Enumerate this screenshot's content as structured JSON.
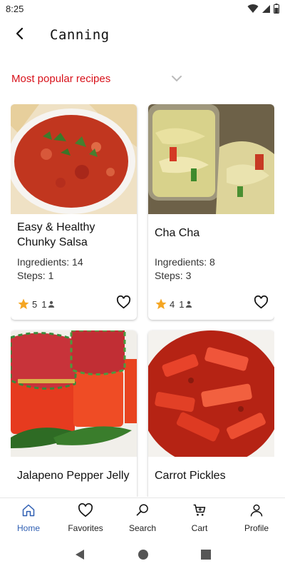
{
  "status_bar": {
    "time": "8:25",
    "icons": [
      "wifi-icon",
      "signal-icon",
      "battery-icon"
    ]
  },
  "app_bar": {
    "title": "Canning",
    "back_icon": "back-arrow-icon"
  },
  "sort": {
    "selected": "Most popular recipes",
    "icon": "chevron-down-icon"
  },
  "colors": {
    "accent": "#d8121b",
    "active_nav": "#2f5fb3",
    "star": "#f5a623"
  },
  "recipes": [
    {
      "title": "Easy & Healthy Chunky Salsa",
      "ingredients": "Ingredients: 14",
      "steps": "Steps: 1",
      "rating": "5",
      "reviews": "1",
      "image": "salsa bowl"
    },
    {
      "title": "Cha Cha",
      "ingredients": "Ingredients: 8",
      "steps": "Steps: 3",
      "rating": "4",
      "reviews": "1",
      "image": "cabbage relish jar"
    },
    {
      "title": "Jalapeno Pepper Jelly",
      "image": "pepper jelly jars"
    },
    {
      "title": "Carrot Pickles",
      "image": "carrot pickles bowl"
    }
  ],
  "nav": [
    {
      "label": "Home",
      "icon": "home-icon",
      "active": true
    },
    {
      "label": "Favorites",
      "icon": "heart-icon"
    },
    {
      "label": "Search",
      "icon": "search-icon"
    },
    {
      "label": "Cart",
      "icon": "cart-icon"
    },
    {
      "label": "Profile",
      "icon": "profile-icon"
    }
  ],
  "system_nav": [
    "back-triangle-icon",
    "home-circle-icon",
    "recents-square-icon"
  ]
}
